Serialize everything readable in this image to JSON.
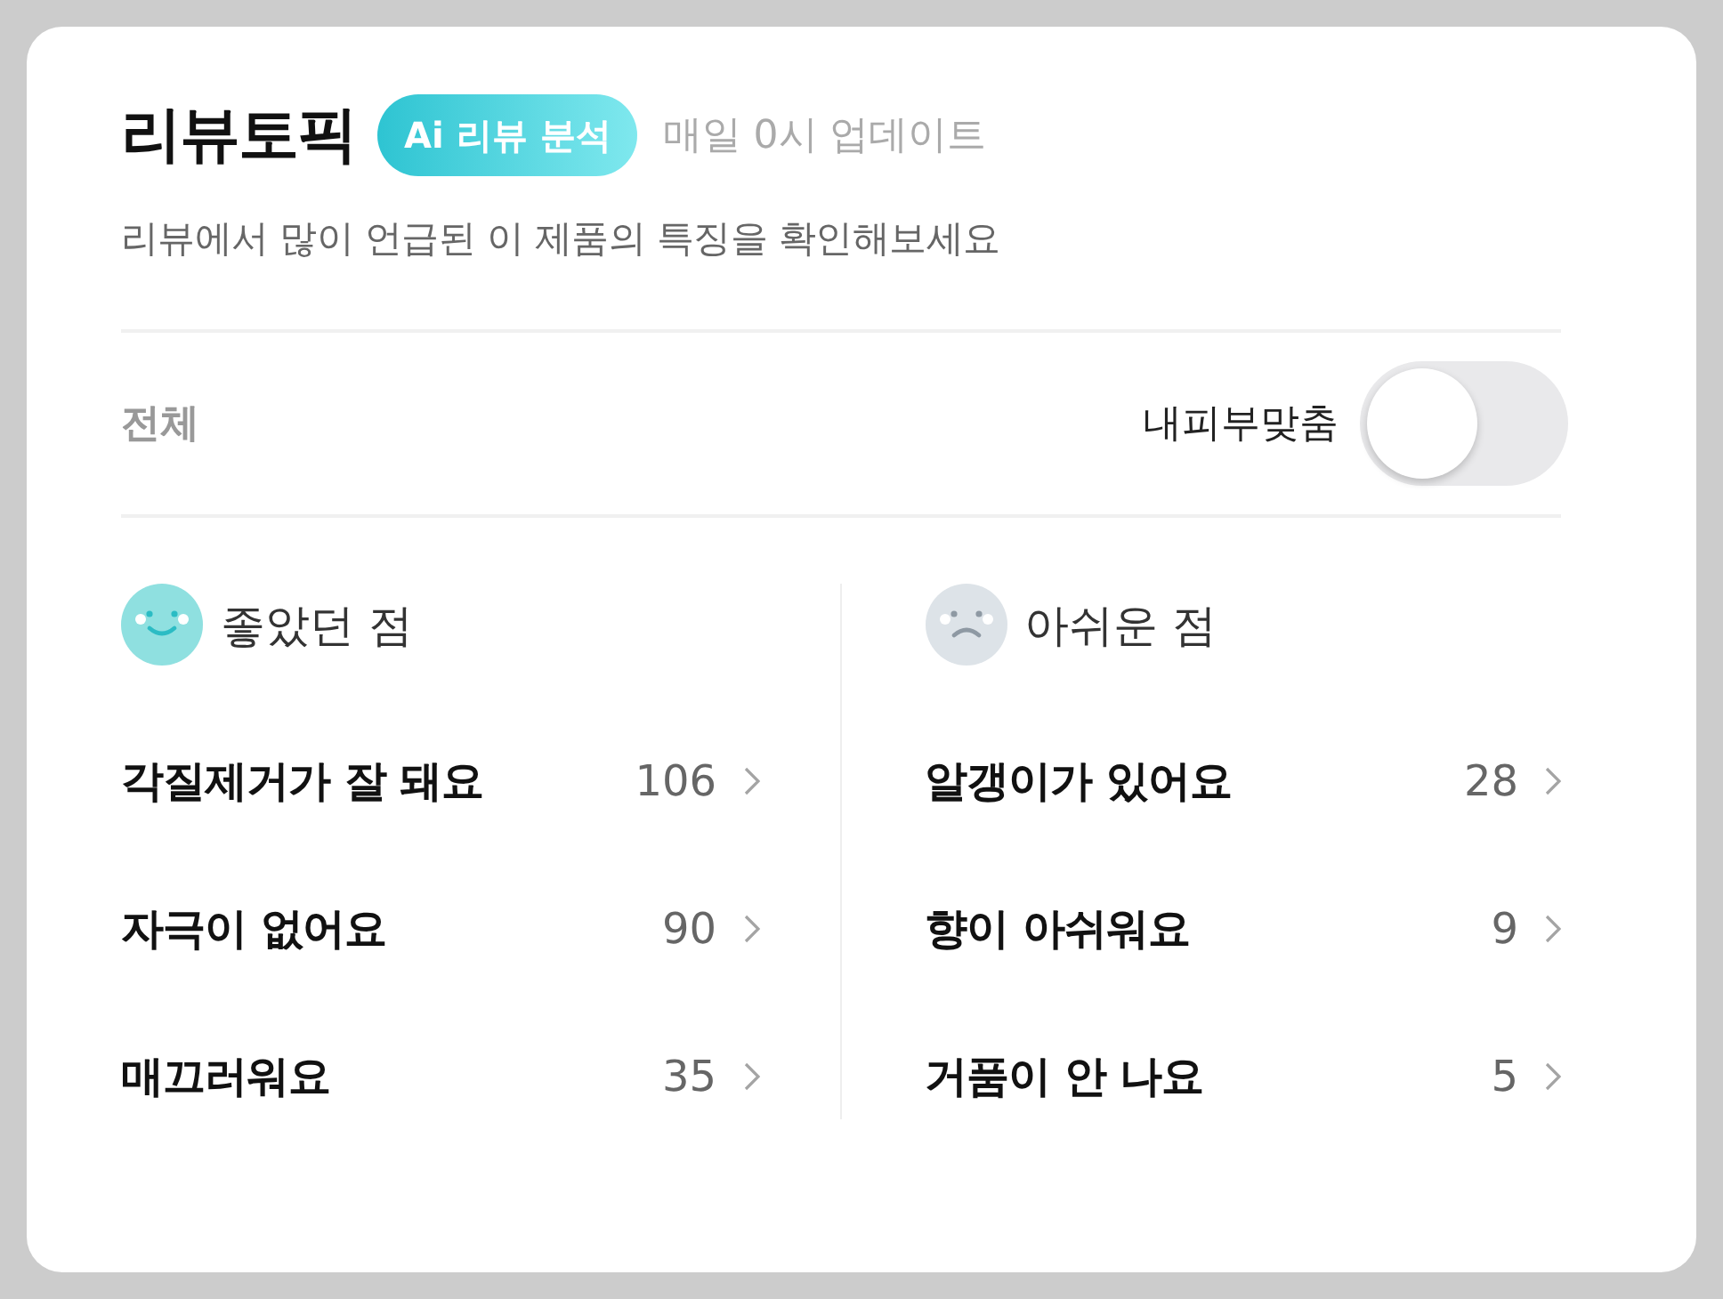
{
  "header": {
    "title": "리뷰토픽",
    "badge": "Ai 리뷰 분석",
    "update_note": "매일 0시 업데이트",
    "subtitle": "리뷰에서 많이 언급된 이 제품의 특징을 확인해보세요"
  },
  "filter": {
    "label": "전체",
    "toggle": {
      "label": "내피부맞춤",
      "on": false
    }
  },
  "sections": [
    {
      "kind": "good",
      "title": "좋았던 점",
      "topics": [
        {
          "label": "각질제거가 잘 돼요",
          "count": "106"
        },
        {
          "label": "자극이 없어요",
          "count": "90"
        },
        {
          "label": "매끄러워요",
          "count": "35"
        }
      ]
    },
    {
      "kind": "bad",
      "title": "아쉬운 점",
      "topics": [
        {
          "label": "알갱이가 있어요",
          "count": "28"
        },
        {
          "label": "향이 아쉬워요",
          "count": "9"
        },
        {
          "label": "거품이 안 나요",
          "count": "5"
        }
      ]
    }
  ]
}
